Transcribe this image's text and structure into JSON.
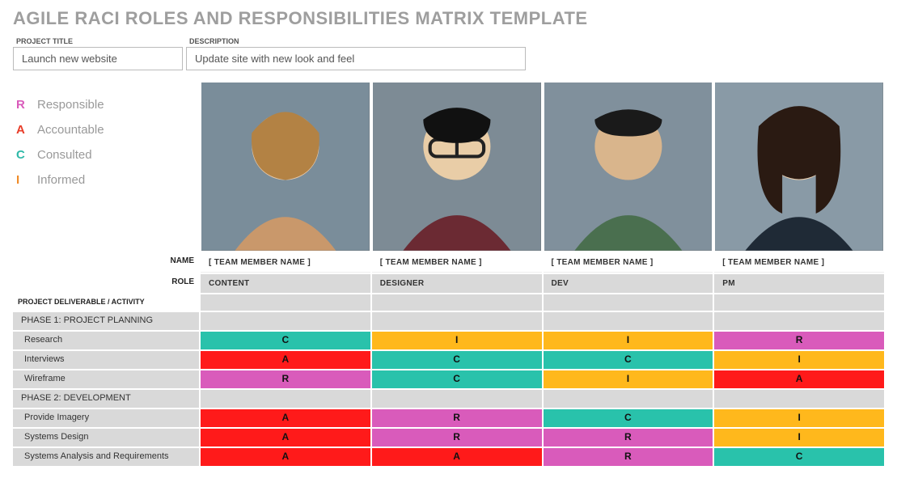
{
  "title": "AGILE RACI ROLES AND RESPONSIBILITIES MATRIX TEMPLATE",
  "meta": {
    "project_label": "PROJECT TITLE",
    "project_value": "Launch new website",
    "description_label": "DESCRIPTION",
    "description_value": "Update site with new look and feel"
  },
  "legend": [
    {
      "letter": "R",
      "word": "Responsible",
      "cls": "lr-R"
    },
    {
      "letter": "A",
      "word": "Accountable",
      "cls": "lr-A"
    },
    {
      "letter": "C",
      "word": "Consulted",
      "cls": "lr-C"
    },
    {
      "letter": "I",
      "word": "Informed",
      "cls": "lr-I"
    }
  ],
  "headers": {
    "name_label": "NAME",
    "role_label": "ROLE",
    "deliverable_label": "PROJECT DELIVERABLE / ACTIVITY"
  },
  "members": [
    {
      "name": "[ TEAM MEMBER NAME ]",
      "role": "CONTENT"
    },
    {
      "name": "[ TEAM MEMBER NAME ]",
      "role": "DESIGNER"
    },
    {
      "name": "[ TEAM MEMBER NAME ]",
      "role": "DEV"
    },
    {
      "name": "[ TEAM MEMBER NAME ]",
      "role": "PM"
    }
  ],
  "phases": [
    {
      "label": "PHASE 1: PROJECT PLANNING",
      "activities": [
        {
          "label": "Research",
          "cells": [
            "C",
            "I",
            "I",
            "R"
          ]
        },
        {
          "label": "Interviews",
          "cells": [
            "A",
            "C",
            "C",
            "I"
          ]
        },
        {
          "label": "Wireframe",
          "cells": [
            "R",
            "C",
            "I",
            "A"
          ]
        }
      ]
    },
    {
      "label": "PHASE 2: DEVELOPMENT",
      "activities": [
        {
          "label": "Provide Imagery",
          "cells": [
            "A",
            "R",
            "C",
            "I"
          ]
        },
        {
          "label": "Systems Design",
          "cells": [
            "A",
            "R",
            "R",
            "I"
          ]
        },
        {
          "label": "Systems Analysis and Requirements",
          "cells": [
            "A",
            "A",
            "R",
            "C"
          ]
        }
      ]
    }
  ],
  "colors": {
    "R": "#d95bbb",
    "A": "#ff1a1a",
    "C": "#29c2ab",
    "I": "#ffb81c"
  }
}
